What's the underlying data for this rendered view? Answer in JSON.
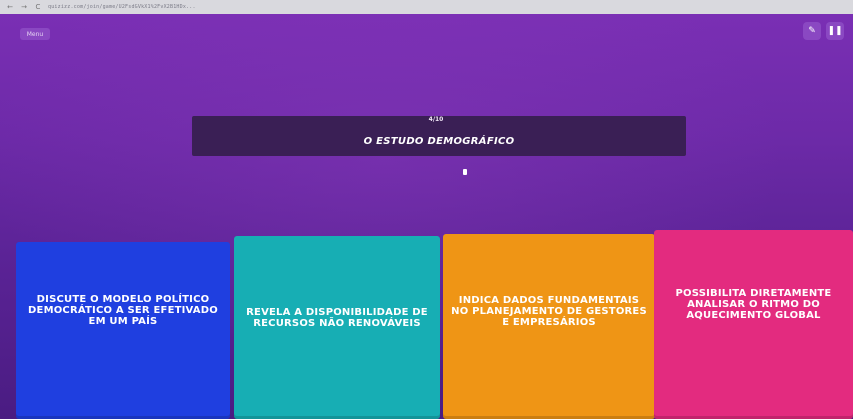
{
  "browser": {
    "back": "←",
    "forward": "→",
    "reload": "C",
    "url": "quizizz.com/join/game/U2FsdGVkX1%2FvX2B1HDx..."
  },
  "header": {
    "menu_label": "Menu",
    "pencil_icon": "✎",
    "pause_icon": "❚❚"
  },
  "question": {
    "counter": "4/10",
    "text": "O ESTUDO DEMOGRÁFICO"
  },
  "answers": [
    {
      "text": "DISCUTE O MODELO POLÍTICO DEMOCRÁTICO A SER EFETIVADO EM UM PAÍS",
      "color": "#1f3fe0"
    },
    {
      "text": "REVELA A DISPONIBILIDADE DE RECURSOS NÃO RENOVÁVEIS",
      "color": "#17aeb4"
    },
    {
      "text": "INDICA DADOS FUNDAMENTAIS NO PLANEJAMENTO DE GESTORES E EMPRESÁRIOS",
      "color": "#ef9515"
    },
    {
      "text": "POSSIBILITA DIRETAMENTE ANALISAR O RITMO DO AQUECIMENTO GLOBAL",
      "color": "#e32b7f"
    }
  ]
}
